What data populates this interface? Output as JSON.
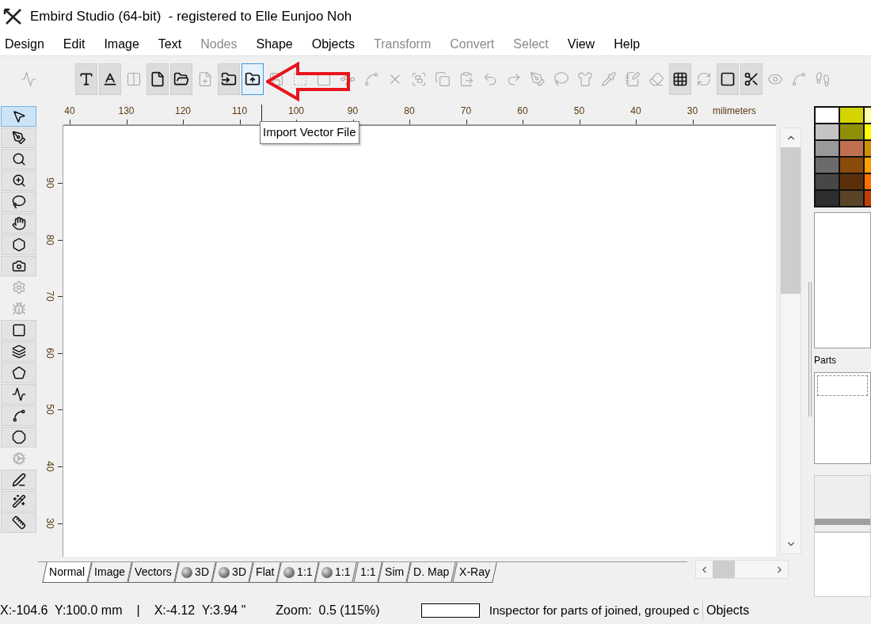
{
  "window": {
    "title": "Embird Studio (64-bit)  - registered to Elle Eunjoo Noh"
  },
  "menu": [
    {
      "label": "Design",
      "disabled": false
    },
    {
      "label": "Edit",
      "disabled": false
    },
    {
      "label": "Image",
      "disabled": false
    },
    {
      "label": "Text",
      "disabled": false
    },
    {
      "label": "Nodes",
      "disabled": true
    },
    {
      "label": "Shape",
      "disabled": false
    },
    {
      "label": "Objects",
      "disabled": false
    },
    {
      "label": "Transform",
      "disabled": true
    },
    {
      "label": "Convert",
      "disabled": true
    },
    {
      "label": "Select",
      "disabled": true
    },
    {
      "label": "View",
      "disabled": false
    },
    {
      "label": "Help",
      "disabled": false
    }
  ],
  "toolbar": [
    {
      "pressed": false,
      "disabled": true,
      "highlighted": false
    },
    {
      "pressed": true,
      "disabled": false,
      "highlighted": false
    },
    {
      "pressed": true,
      "disabled": false,
      "highlighted": false
    },
    {
      "pressed": false,
      "disabled": true,
      "highlighted": false
    },
    {
      "pressed": true,
      "disabled": false,
      "highlighted": false
    },
    {
      "pressed": true,
      "disabled": false,
      "highlighted": false
    },
    {
      "pressed": false,
      "disabled": true,
      "highlighted": false
    },
    {
      "pressed": true,
      "disabled": false,
      "highlighted": false
    },
    {
      "pressed": false,
      "disabled": false,
      "highlighted": true
    },
    {
      "pressed": false,
      "disabled": true,
      "highlighted": false
    },
    {
      "pressed": false,
      "disabled": true,
      "highlighted": false
    },
    {
      "pressed": false,
      "disabled": true,
      "highlighted": false
    },
    {
      "pressed": false,
      "disabled": true,
      "highlighted": false
    },
    {
      "pressed": false,
      "disabled": true,
      "highlighted": false
    },
    {
      "pressed": false,
      "disabled": true,
      "highlighted": false
    },
    {
      "pressed": false,
      "disabled": true,
      "highlighted": false
    },
    {
      "pressed": false,
      "disabled": true,
      "highlighted": false
    },
    {
      "pressed": false,
      "disabled": true,
      "highlighted": false
    },
    {
      "pressed": false,
      "disabled": true,
      "highlighted": false
    },
    {
      "pressed": false,
      "disabled": true,
      "highlighted": false
    },
    {
      "pressed": false,
      "disabled": true,
      "highlighted": false
    },
    {
      "pressed": false,
      "disabled": true,
      "highlighted": false
    },
    {
      "pressed": false,
      "disabled": true,
      "highlighted": false
    },
    {
      "pressed": false,
      "disabled": true,
      "highlighted": false
    },
    {
      "pressed": false,
      "disabled": true,
      "highlighted": false
    },
    {
      "pressed": false,
      "disabled": true,
      "highlighted": false
    },
    {
      "pressed": true,
      "disabled": false,
      "highlighted": false
    },
    {
      "pressed": false,
      "disabled": true,
      "highlighted": false
    },
    {
      "pressed": true,
      "disabled": false,
      "highlighted": false
    },
    {
      "pressed": true,
      "disabled": false,
      "highlighted": false
    },
    {
      "pressed": false,
      "disabled": true,
      "highlighted": false
    },
    {
      "pressed": false,
      "disabled": true,
      "highlighted": false
    },
    {
      "pressed": false,
      "disabled": true,
      "highlighted": false
    }
  ],
  "tooltip": "Import Vector File",
  "tools": [
    {
      "selected": true,
      "disabled": false
    },
    {
      "selected": false,
      "disabled": false
    },
    {
      "selected": false,
      "disabled": false
    },
    {
      "selected": false,
      "disabled": false
    },
    {
      "selected": false,
      "disabled": false
    },
    {
      "selected": false,
      "disabled": false
    },
    {
      "selected": false,
      "disabled": false
    },
    {
      "selected": false,
      "disabled": false
    },
    {
      "selected": false,
      "disabled": true
    },
    {
      "selected": false,
      "disabled": true
    },
    {
      "selected": false,
      "disabled": false
    },
    {
      "selected": false,
      "disabled": false
    },
    {
      "selected": false,
      "disabled": false
    },
    {
      "selected": false,
      "disabled": false
    },
    {
      "selected": false,
      "disabled": false
    },
    {
      "selected": false,
      "disabled": false
    },
    {
      "selected": false,
      "disabled": true
    },
    {
      "selected": false,
      "disabled": false
    },
    {
      "selected": false,
      "disabled": false
    },
    {
      "selected": false,
      "disabled": false
    }
  ],
  "ruler_top": {
    "labels": [
      "40",
      "130",
      "120",
      "110",
      "100",
      "90",
      "80",
      "70",
      "60",
      "50",
      "40",
      "30"
    ],
    "unit": "milimeters"
  },
  "ruler_left": {
    "labels": [
      "90",
      "80",
      "70",
      "60",
      "50",
      "40",
      "30"
    ]
  },
  "view_tabs": [
    {
      "label": "Normal",
      "kind": "plain",
      "selected": true
    },
    {
      "label": "Image",
      "kind": "plain",
      "selected": false
    },
    {
      "label": "Vectors",
      "kind": "plain",
      "selected": false
    },
    {
      "label": "3D",
      "kind": "sphere",
      "selected": false
    },
    {
      "label": "3D",
      "kind": "sphere",
      "selected": false
    },
    {
      "label": "Flat",
      "kind": "plain",
      "selected": false
    },
    {
      "label": "1:1",
      "kind": "sphere",
      "selected": false
    },
    {
      "label": "1:1",
      "kind": "sphere",
      "selected": false
    },
    {
      "label": "1:1",
      "kind": "plain",
      "selected": false
    },
    {
      "label": "Sim",
      "kind": "plain",
      "selected": false
    },
    {
      "label": "D. Map",
      "kind": "plain",
      "selected": false
    },
    {
      "label": "X-Ray",
      "kind": "plain",
      "selected": false
    }
  ],
  "palette": [
    {
      "color": "#ffffff"
    },
    {
      "color": "#d4d400"
    },
    {
      "color": "#ffffa8"
    },
    {
      "color": "#c4c4c4"
    },
    {
      "color": "#8f8f0a"
    },
    {
      "color": "#ffff00"
    },
    {
      "color": "#999999"
    },
    {
      "color": "#c07050"
    },
    {
      "color": "#d09000"
    },
    {
      "color": "#6b6b6b"
    },
    {
      "color": "#8a4a0a"
    },
    {
      "color": "#ffa000"
    },
    {
      "color": "#474747"
    },
    {
      "color": "#5a300a"
    },
    {
      "color": "#ff7000"
    },
    {
      "color": "#2e2e2e"
    },
    {
      "color": "#5a4428"
    },
    {
      "color": "#c04000"
    }
  ],
  "parts_label": "Parts",
  "status_bar": {
    "coords_mm": "X:-104.6  Y:100.0 mm",
    "separator": "|",
    "coords_in": "X:-4.12  Y:3.94 \"",
    "zoom": "Zoom:  0.5 (115%)",
    "message": "Inspector for parts of joined, grouped c",
    "panel": "Objects"
  }
}
